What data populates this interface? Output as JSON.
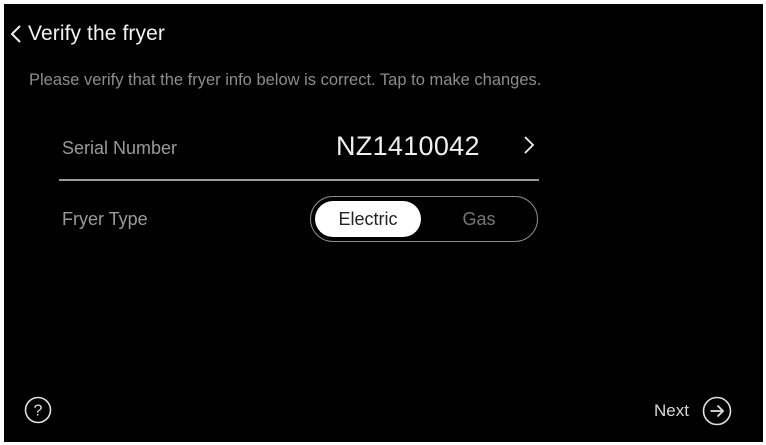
{
  "header": {
    "back_title": "Verify the fryer",
    "back_icon": "chevron-left-icon"
  },
  "instructions": "Please verify that the fryer info below is correct. Tap to make changes.",
  "serial": {
    "label": "Serial Number",
    "value": "NZ1410042",
    "icon": "chevron-right-icon"
  },
  "fryer_type": {
    "label": "Fryer Type",
    "options": [
      "Electric",
      "Gas"
    ],
    "selected": "Electric"
  },
  "footer": {
    "help_icon": "question-circle-icon",
    "next_label": "Next",
    "next_icon": "arrow-right-circle-icon"
  },
  "colors": {
    "background": "#000000",
    "text": "#f0f0f0",
    "muted_text": "#9a9a9a",
    "toggle_selected_bg": "#ffffff"
  }
}
